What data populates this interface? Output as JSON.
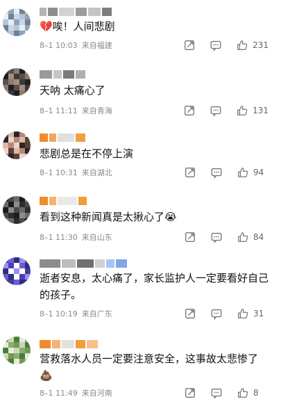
{
  "comments": [
    {
      "text": "💔唉！人间悲剧",
      "time": "8–1 10:03",
      "location": "来自福建",
      "likes": "231",
      "avatar_colors": [
        "#c7d7e8",
        "#8fa4b8",
        "#e6eef5",
        "#6f8296",
        "#b7c6d4"
      ],
      "name_blocks": [
        "#b5b5b5",
        "#8d8d8d",
        "#d2d2d2",
        "#9c9c9c",
        "#c4c4c4",
        "#7e7e7e"
      ]
    },
    {
      "text": "天呐  太痛心了",
      "time": "8–1 11:11",
      "location": "来自青海",
      "likes": "131",
      "avatar_colors": [
        "#3a3a3a",
        "#5a4f4a",
        "#8a7b70",
        "#1f1f1f",
        "#a58e7c"
      ],
      "name_blocks": [
        "#9a9a9a",
        "#c6c6c6",
        "#7a7a7a",
        "#b0b0b0"
      ]
    },
    {
      "text": "悲剧总是在不停上演",
      "time": "8–1 10:31",
      "location": "来自湖北",
      "likes": "94",
      "avatar_colors": [
        "#5b4136",
        "#d9b8a7",
        "#2c2523",
        "#b5867b",
        "#efd3c6"
      ],
      "name_blocks": [
        "#f28a2e",
        "#f6a45b",
        "#e0e0e0",
        "#f0a040"
      ]
    },
    {
      "text": "看到这种新闻真是太揪心了😭",
      "time": "8–1 11:30",
      "location": "来自山东",
      "likes": "84",
      "avatar_colors": [
        "#2d2d2d",
        "#4a4a4a",
        "#6b6b6b",
        "#1c1c1c",
        "#8c8c8c"
      ],
      "name_blocks": [
        "#f08a2e",
        "#f7b267",
        "#e9e9e9",
        "#f39c3c"
      ]
    },
    {
      "text": "逝者安息，太心痛了，家长监护人一定要看好自己的孩子。",
      "time": "8–1 10:19",
      "location": "来自广东",
      "likes": "31",
      "avatar_colors": [
        "#3a3f9c",
        "#6b5fd1",
        "#2a2e80",
        "#9a8ff0",
        "#4b3fb5"
      ],
      "name_blocks": [
        "#8c8c8c",
        "#bdbdbd",
        "#707070",
        "#d0d0d0",
        "#a7c4f2",
        "#7fa7e8"
      ]
    },
    {
      "text": "营救落水人员一定要注意安全，这事故太悲惨了💩",
      "time": "8–1 11:49",
      "location": "来自河南",
      "likes": "8",
      "avatar_colors": [
        "#6f9a56",
        "#c9d8b8",
        "#4e7a3e",
        "#e6ecd8",
        "#8cae70"
      ],
      "name_blocks": [
        "#f08a2e",
        "#f6b073",
        "#e0e0e0",
        "#f39c3c",
        "#f7c08a"
      ]
    }
  ]
}
